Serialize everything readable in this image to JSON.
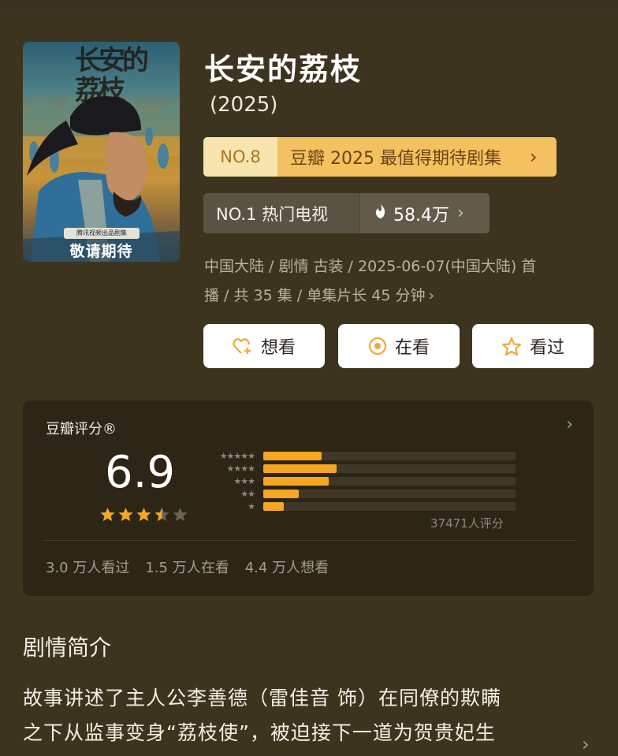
{
  "poster": {
    "calligraphy": "长安的荔枝",
    "tag": "腾讯视频出品剧集",
    "cta": "敬请期待"
  },
  "title": "长安的荔枝",
  "year": "(2025)",
  "ranks": {
    "douban_rank": {
      "no": "NO.8",
      "text": "豆瓣 2025 最值得期待剧集"
    },
    "hot_rank": {
      "label": "NO.1 热门电视",
      "value": "58.4万"
    }
  },
  "meta": {
    "line1": "中国大陆 / 剧情 古装 / 2025-06-07(中国大陆) 首",
    "line2": "播 / 共 35 集 / 单集片长 45 分钟"
  },
  "buttons": {
    "want": "想看",
    "watching": "在看",
    "watched": "看过"
  },
  "rating": {
    "title": "豆瓣评分®",
    "score": "6.9",
    "stars_value": 3.5,
    "count_text": "37471人评分",
    "distribution": [
      {
        "stars": 5,
        "fraction": 0.23
      },
      {
        "stars": 4,
        "fraction": 0.29
      },
      {
        "stars": 3,
        "fraction": 0.26
      },
      {
        "stars": 2,
        "fraction": 0.14
      },
      {
        "stars": 1,
        "fraction": 0.08
      }
    ],
    "stats": [
      "3.0 万人看过",
      "1.5 万人在看",
      "4.4 万人想看"
    ]
  },
  "synopsis": {
    "title": "剧情简介",
    "line1": "故事讲述了主人公李善德（雷佳音 饰）在同僚的欺瞒",
    "line2": "之下从监事变身“荔枝使”，被迫接下一道为贺贵妃生"
  },
  "colors": {
    "background": "#3d3420",
    "accent_star": "#f5a623",
    "rank_highlight": "#f5c060"
  }
}
